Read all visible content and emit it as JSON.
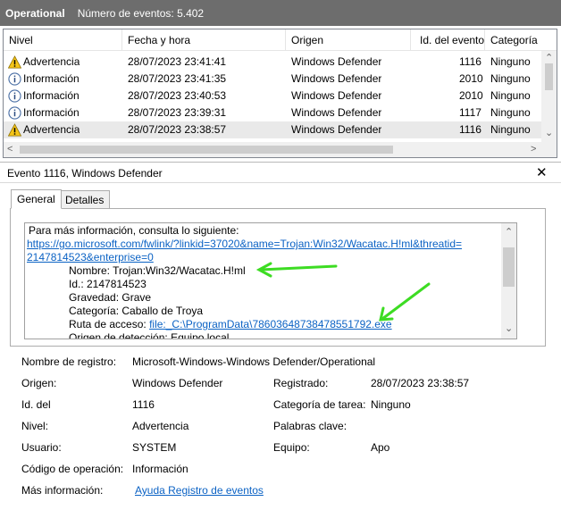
{
  "titlebar": {
    "log_name": "Operational",
    "event_count": "Número de eventos: 5.402"
  },
  "grid": {
    "columns": [
      "Nivel",
      "Fecha y hora",
      "Origen",
      "Id. del evento",
      "Categoría"
    ],
    "rows": [
      {
        "level": "Advertencia",
        "icon": "warning-icon",
        "datetime": "28/07/2023 23:41:41",
        "source": "Windows Defender",
        "id": "1116",
        "category": "Ninguno"
      },
      {
        "level": "Información",
        "icon": "info-icon",
        "datetime": "28/07/2023 23:41:35",
        "source": "Windows Defender",
        "id": "2010",
        "category": "Ninguno"
      },
      {
        "level": "Información",
        "icon": "info-icon",
        "datetime": "28/07/2023 23:40:53",
        "source": "Windows Defender",
        "id": "2010",
        "category": "Ninguno"
      },
      {
        "level": "Información",
        "icon": "info-icon",
        "datetime": "28/07/2023 23:39:31",
        "source": "Windows Defender",
        "id": "1117",
        "category": "Ninguno"
      },
      {
        "level": "Advertencia",
        "icon": "warning-icon",
        "datetime": "28/07/2023 23:38:57",
        "source": "Windows Defender",
        "id": "1116",
        "category": "Ninguno",
        "selected": true
      }
    ]
  },
  "detail": {
    "title": "Evento 1116, Windows Defender",
    "tabs": [
      "General",
      "Detalles"
    ],
    "message": {
      "intro": "Para más información, consulta lo siguiente:",
      "link1": "https://go.microsoft.com/fwlink/?linkid=37020&name=Trojan:Win32/Wacatac.H!ml&threatid=",
      "link2": "2147814523&enterprise=0",
      "name": "Nombre: Trojan:Win32/Wacatac.H!ml",
      "id": "Id.: 2147814523",
      "severity": "Gravedad: Grave",
      "category": "Categoría: Caballo de Troya",
      "path_label": "Ruta de acceso: ",
      "path_value": "file:_C:\\ProgramData\\78603648738478551792.exe",
      "detection_origin": "Origen de detección: Equipo local"
    },
    "annotation_color": "#3ddc23",
    "properties": {
      "log_name_label": "Nombre de registro:",
      "log_name_value": "Microsoft-Windows-Windows Defender/Operational",
      "source_label": "Origen:",
      "source_value": "Windows Defender",
      "logged_label": "Registrado:",
      "logged_value": "28/07/2023 23:38:57",
      "event_id_label": "Id. del",
      "event_id_value": "1116",
      "task_category_label": "Categoría de tarea:",
      "task_category_value": "Ninguno",
      "level_label": "Nivel:",
      "level_value": "Advertencia",
      "keywords_label": "Palabras clave:",
      "user_label": "Usuario:",
      "user_value": "SYSTEM",
      "computer_label": "Equipo:",
      "computer_value": "Apo",
      "opcode_label": "Código de operación:",
      "opcode_value": "Información",
      "more_info_label": "Más información:",
      "more_info_link": "Ayuda Registro de eventos"
    }
  }
}
